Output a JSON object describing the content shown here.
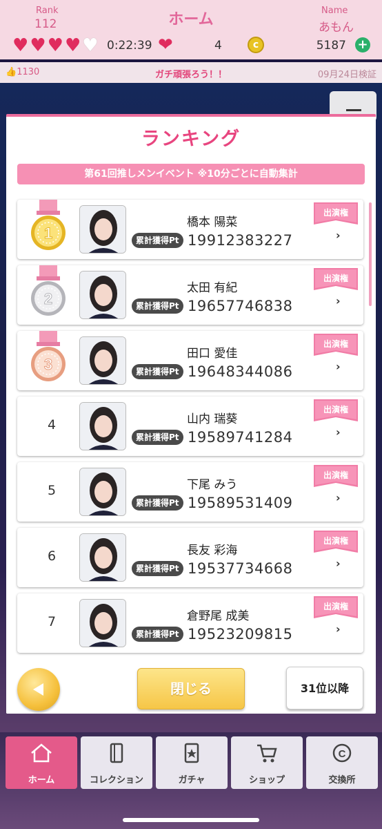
{
  "status": {
    "rank_label": "Rank",
    "rank_value": "112",
    "title": "ホーム",
    "name_label": "Name",
    "name_value": "あもん",
    "timer": "0:22:39",
    "hearts_count": "4",
    "coins": "5187",
    "hearts_full": 4,
    "hearts_total": 5
  },
  "info_bar": {
    "likes": "1130",
    "message": "ガチ頑張ろう！！",
    "date": "09月24日検証"
  },
  "modal": {
    "title": "ランキング",
    "event_banner": "第61回推しメンイベント ※10分ごとに自動集計",
    "pt_label": "累計獲得Pt",
    "tag_label": "出演権",
    "close_label": "閉じる",
    "next_label": "31位以降"
  },
  "ranking": [
    {
      "rank": "1",
      "name": "橋本 陽菜",
      "points": "19912383227",
      "medal": "gold"
    },
    {
      "rank": "2",
      "name": "太田 有紀",
      "points": "19657746838",
      "medal": "silver"
    },
    {
      "rank": "3",
      "name": "田口 愛佳",
      "points": "19648344086",
      "medal": "bronze"
    },
    {
      "rank": "4",
      "name": "山内 瑞葵",
      "points": "19589741284",
      "medal": ""
    },
    {
      "rank": "5",
      "name": "下尾 みう",
      "points": "19589531409",
      "medal": ""
    },
    {
      "rank": "6",
      "name": "長友 彩海",
      "points": "19537734668",
      "medal": ""
    },
    {
      "rank": "7",
      "name": "倉野尾 成美",
      "points": "19523209815",
      "medal": ""
    }
  ],
  "nav": [
    {
      "label": "ホーム",
      "icon": "home-icon",
      "active": true
    },
    {
      "label": "コレクション",
      "icon": "collection-icon",
      "active": false
    },
    {
      "label": "ガチャ",
      "icon": "gacha-icon",
      "active": false
    },
    {
      "label": "ショップ",
      "icon": "cart-icon",
      "active": false
    },
    {
      "label": "交換所",
      "icon": "exchange-icon",
      "active": false
    }
  ],
  "colors": {
    "accent_pink": "#e8457f",
    "banner_pink": "#f690b4",
    "gold": "#f5c03c",
    "silver": "#c9c9cc",
    "bronze": "#e9a88a"
  }
}
